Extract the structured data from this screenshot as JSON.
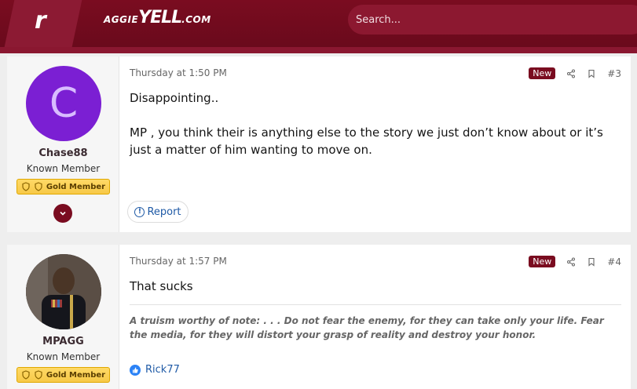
{
  "header": {
    "logo_letter": "r",
    "brand_part1": "AGGIE",
    "brand_part2": "YELL",
    "brand_part3": ".COM",
    "search_placeholder": "Search..."
  },
  "posts": [
    {
      "user": {
        "avatar_letter": "C",
        "name": "Chase88",
        "title": "Known Member",
        "badge": "Gold Member"
      },
      "timestamp": "Thursday at 1:50 PM",
      "new_label": "New",
      "number": "#3",
      "body_line1": "Disappointing..",
      "body_line2": "MP , you think their is anything else to the story we just don’t know about or it’s just a matter of him wanting to move on.",
      "report_label": "Report"
    },
    {
      "user": {
        "name": "MPAGG",
        "title": "Known Member",
        "badge": "Gold Member"
      },
      "timestamp": "Thursday at 1:57 PM",
      "new_label": "New",
      "number": "#4",
      "body_line1": "That sucks",
      "signature": "A truism worthy of note: . . . Do not fear the enemy, for they can take only your life. Fear the media, for they will distort your grasp of reality and destroy your honor.",
      "reaction_user": "Rick77"
    }
  ],
  "colors": {
    "brand": "#7a0c20",
    "link": "#1f5aa6",
    "avatar_purple": "#7b1fd3",
    "gold": "#f7c948"
  }
}
